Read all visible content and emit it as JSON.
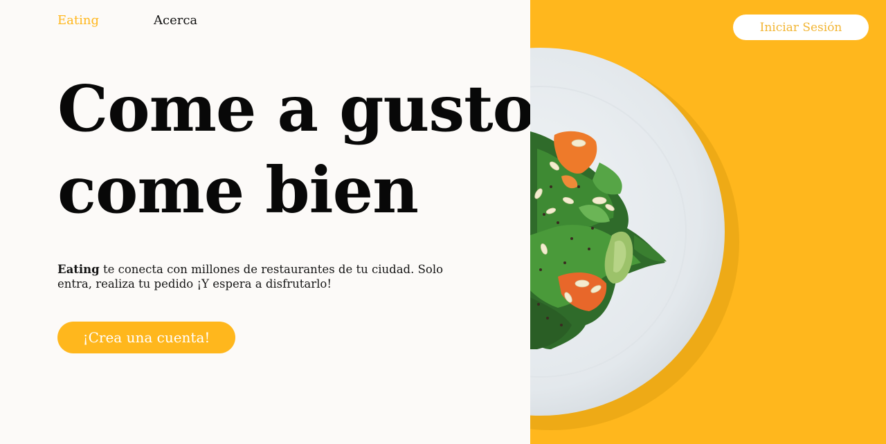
{
  "nav": {
    "brand": "Eating",
    "about": "Acerca"
  },
  "header": {
    "login_label": "Iniciar Sesión"
  },
  "hero": {
    "headline_line1": "Come a gusto,",
    "headline_line2": "come bien",
    "description_brand": "Eating",
    "description_rest": " te conecta con millones de restaurantes de tu ciudad. Solo entra, realiza tu pedido ¡Y espera a disfrutarlo!",
    "cta_label": "¡Crea una cuenta!"
  },
  "colors": {
    "accent": "#ffb71d",
    "background": "#fcfaf8",
    "text": "#080808"
  }
}
